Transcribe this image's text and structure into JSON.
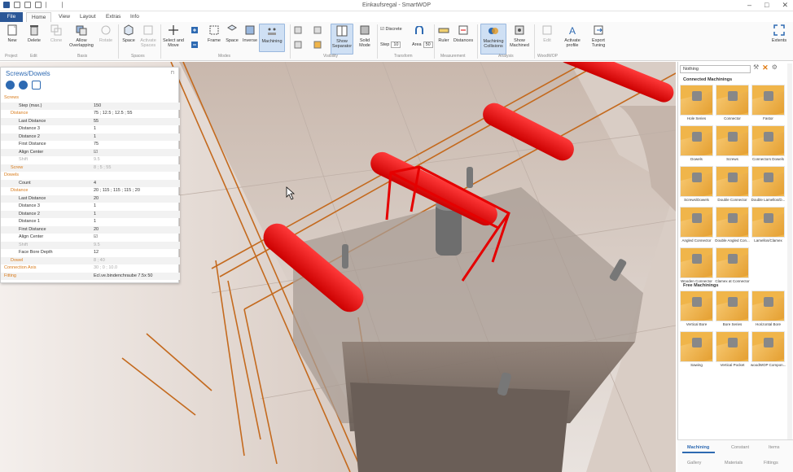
{
  "window": {
    "title": "Einkaufsregal - SmartWOP"
  },
  "ribbon_tabs": [
    "File",
    "Home",
    "View",
    "Layout",
    "Extras",
    "Info"
  ],
  "ribbon": {
    "buttons": {
      "new": "New",
      "delete": "Delete",
      "clone": "Clone",
      "allow_overlapping": "Allow Overlapping",
      "rotate": "Rotate",
      "space": "Space",
      "activate_spaces": "Activate Spaces",
      "select_and_move": "Select and Move",
      "frame": "Frame",
      "space2": "Space",
      "inverse": "Inverse",
      "machining": "Machining",
      "show_separator": "Show Separator",
      "solid_mode": "Solid Mode",
      "discrete": "Discrete",
      "step_label": "Step",
      "step_value": "10",
      "area_label": "Area",
      "area_value": "50",
      "ruler": "Ruler",
      "distances": "Distances",
      "machining_collisions": "Machining Collisions",
      "show_machined": "Show Machined",
      "edit": "Edit",
      "activate_profile": "Activate profile",
      "export_tuning": "Export Tuning",
      "extents": "Extents"
    },
    "groups": [
      "Project",
      "Edit",
      "Basis",
      "Spaces",
      "Modes",
      "Visibility",
      "Transform",
      "Measurement",
      "Analysis",
      "WoodWOP"
    ]
  },
  "panel": {
    "title": "Screws/Dowels",
    "rows": [
      {
        "label": "Screws",
        "value": "",
        "kind": "cat"
      },
      {
        "label": "Step (max.)",
        "value": "150",
        "kind": "prop"
      },
      {
        "label": "Distance",
        "value": "75 ; 12.5 ; 12.5 ; 55",
        "kind": "sub"
      },
      {
        "label": "Last Distance",
        "value": "55",
        "kind": "prop"
      },
      {
        "label": "Distance 3",
        "value": "1",
        "kind": "prop"
      },
      {
        "label": "Distance 2",
        "value": "1",
        "kind": "prop"
      },
      {
        "label": "First Distance",
        "value": "75",
        "kind": "prop"
      },
      {
        "label": "Align Center",
        "value": "☑",
        "kind": "prop"
      },
      {
        "label": "Shift",
        "value": "9.5",
        "kind": "dis"
      },
      {
        "label": "Screw",
        "value": "8 ; 5 ; 55",
        "kind": "subdis"
      },
      {
        "label": "Dowels",
        "value": "",
        "kind": "cat"
      },
      {
        "label": "Count",
        "value": "4",
        "kind": "prop"
      },
      {
        "label": "Distance",
        "value": "20 ; 115 ; 115 ; 115 ; 20",
        "kind": "sub"
      },
      {
        "label": "Last Distance",
        "value": "20",
        "kind": "prop"
      },
      {
        "label": "Distance 3",
        "value": "1",
        "kind": "prop"
      },
      {
        "label": "Distance 2",
        "value": "1",
        "kind": "prop"
      },
      {
        "label": "Distance 1",
        "value": "1",
        "kind": "prop"
      },
      {
        "label": "First Distance",
        "value": "20",
        "kind": "prop"
      },
      {
        "label": "Align Center",
        "value": "☑",
        "kind": "prop"
      },
      {
        "label": "Shift",
        "value": "9.5",
        "kind": "dis"
      },
      {
        "label": "Face Bore Depth",
        "value": "12",
        "kind": "prop"
      },
      {
        "label": "Dowel",
        "value": "8 ; 40",
        "kind": "subdis"
      },
      {
        "label": "Connection Axis",
        "value": "30 ; 0 ; 10.0",
        "kind": "catdis"
      },
      {
        "label": "Fitting",
        "value": "Ecl.ve.bindenchraube 7.5x 50",
        "kind": "cat"
      }
    ]
  },
  "gallery": {
    "dropdown": "Nothing",
    "connected_title": "Connected Machinings",
    "connected": [
      "Hole Series",
      "Connector",
      "Fastor",
      "Dowels",
      "Screws",
      "Connectors Dowels",
      "Screws/Dowels",
      "Double Connector",
      "Double Lamellos/D...",
      "Angled Connector",
      "Double Angled Con...",
      "Lamellos/Clamex",
      "Wooden Connector",
      "Clamex at Connector"
    ],
    "free_title": "Free Machinings",
    "free": [
      "Vertical Bore",
      "Bore Series",
      "Horizontal Bore",
      "Sawing",
      "Vertical Pocket",
      "woodWOP Compon..."
    ]
  },
  "bottom_tabs": [
    "Machining",
    "Constant",
    "Items",
    "Gallery",
    "Materials",
    "Fittings"
  ],
  "colors": {
    "accent": "#2b5797",
    "screw_red": "#e50000",
    "wood": "#f0b54a",
    "frame_lines": "#c46a1e"
  }
}
